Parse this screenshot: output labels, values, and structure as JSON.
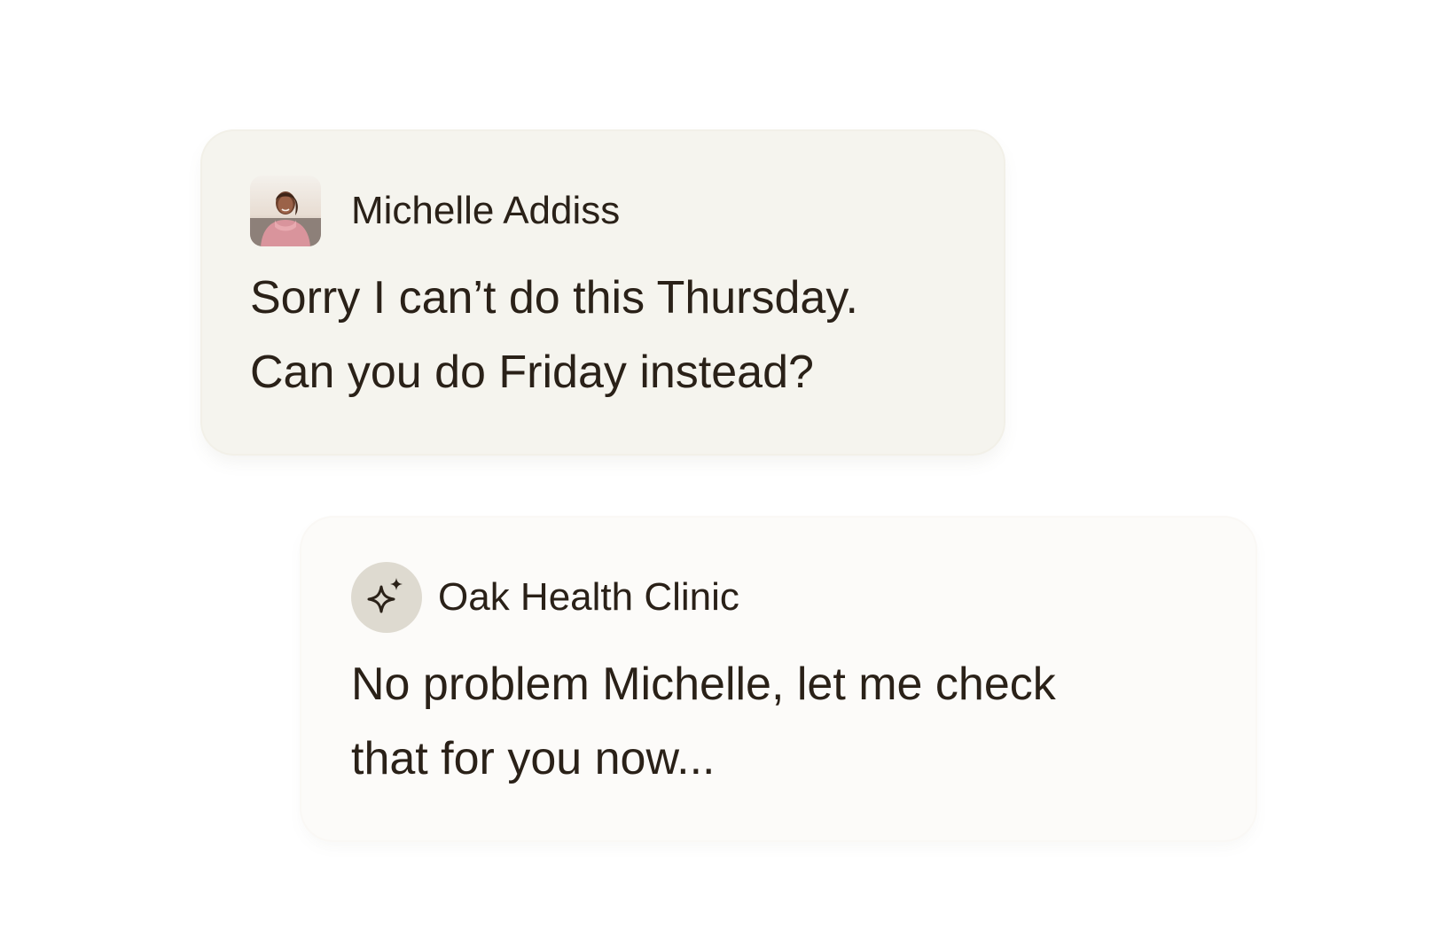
{
  "conversation": {
    "messages": [
      {
        "sender": "Michelle Addiss",
        "avatar_icon": "user-photo-icon",
        "lines": [
          "Sorry I can’t do this Thursday.",
          "Can you do Friday instead?"
        ]
      },
      {
        "sender": "Oak Health Clinic",
        "avatar_icon": "sparkle-icon",
        "lines": [
          "No problem Michelle, let me check",
          "that for you now..."
        ]
      }
    ]
  },
  "colors": {
    "text": "#2a2118",
    "incoming_bubble": "#f5f4ee",
    "outgoing_bubble": "#fcfbf9",
    "ai_avatar_bg": "#dedad0"
  }
}
